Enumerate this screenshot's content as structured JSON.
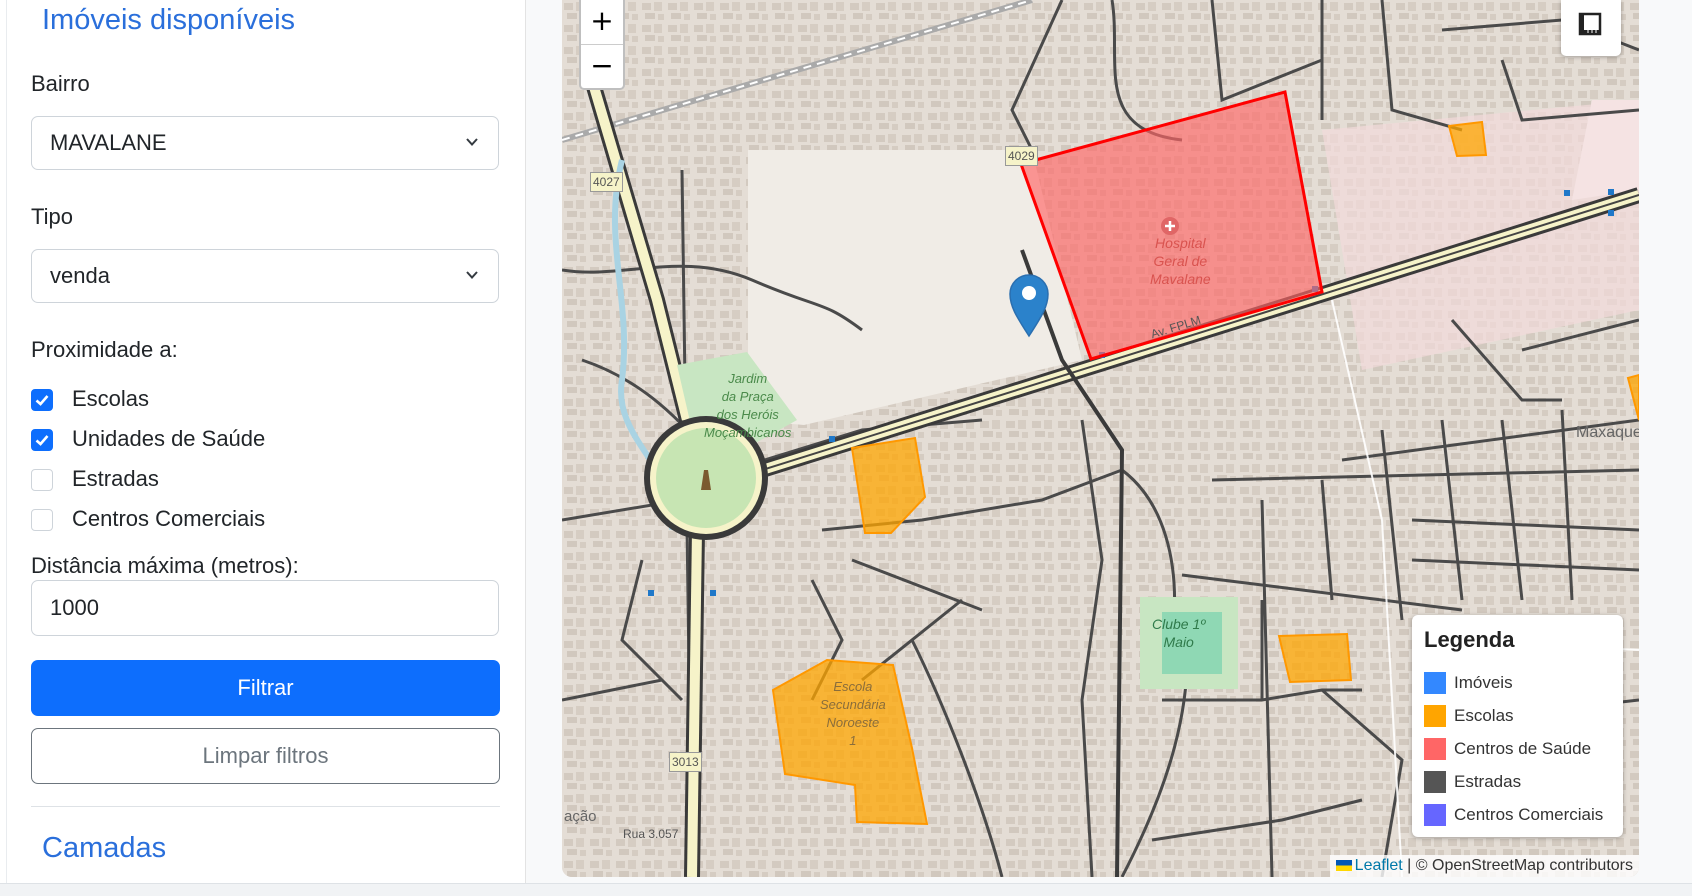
{
  "sidebar": {
    "title": "Imóveis disponíveis",
    "bairro_label": "Bairro",
    "bairro_value": "MAVALANE",
    "tipo_label": "Tipo",
    "tipo_value": "venda",
    "proximidade_label": "Proximidade a:",
    "checkboxes": [
      {
        "label": "Escolas",
        "checked": true
      },
      {
        "label": "Unidades de Saúde",
        "checked": true
      },
      {
        "label": "Estradas",
        "checked": false
      },
      {
        "label": "Centros Comerciais",
        "checked": false
      }
    ],
    "distancia_label": "Distância máxima (metros):",
    "distancia_value": "1000",
    "filter_button": "Filtrar",
    "clear_button": "Limpar filtros",
    "layers_title": "Camadas"
  },
  "map": {
    "zoom_in": "+",
    "zoom_out": "−",
    "labels": {
      "hospital": [
        "Hospital",
        "Geral de",
        "Mavalane"
      ],
      "jardim": [
        "Jardim",
        "da Praça",
        "dos Heróis",
        "Moçambicanos"
      ],
      "escola": [
        "Escola",
        "Secundária",
        "Noroeste",
        "1"
      ],
      "clube": [
        "Clube 1º",
        "Maio"
      ],
      "maxaquene": "Maxaquene",
      "road_4027": "4027",
      "road_4029": "4029",
      "road_3013": "3013",
      "street_rua3057": "Rua 3.057",
      "street_av": "Av. FPLM",
      "fragment_acao": "ação"
    },
    "legend": {
      "title": "Legenda",
      "items": [
        {
          "label": "Imóveis",
          "color": "#3388ff"
        },
        {
          "label": "Escolas",
          "color": "#ffa500"
        },
        {
          "label": "Centros de Saúde",
          "color": "#ff6666"
        },
        {
          "label": "Estradas",
          "color": "#555555"
        },
        {
          "label": "Centros Comerciais",
          "color": "#6666ff"
        }
      ]
    },
    "attribution": {
      "leaflet": "Leaflet",
      "separator": " | © ",
      "osm": "OpenStreetMap contributors"
    }
  }
}
